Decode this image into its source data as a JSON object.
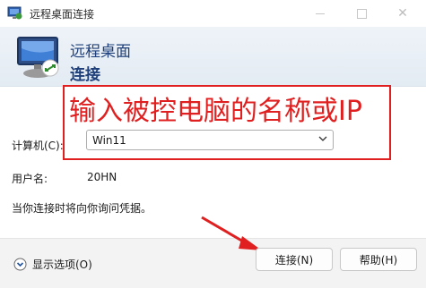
{
  "window": {
    "title": "远程桌面连接"
  },
  "banner": {
    "title": "远程桌面",
    "subtitle": "连接"
  },
  "annotation": {
    "text": "输入被控电脑的名称或IP",
    "color": "#e02020"
  },
  "form": {
    "computer_label": "计算机(C):",
    "computer_value": "Win11",
    "username_label": "用户名:",
    "username_value": "20HN",
    "hint": "当你连接时将向你询问凭据。"
  },
  "footer": {
    "options_label": "显示选项(O)",
    "connect_button": "连接(N)",
    "help_button": "帮助(H)"
  },
  "colors": {
    "accent_blue": "#1e3f7a",
    "annotation_red": "#e02020"
  }
}
